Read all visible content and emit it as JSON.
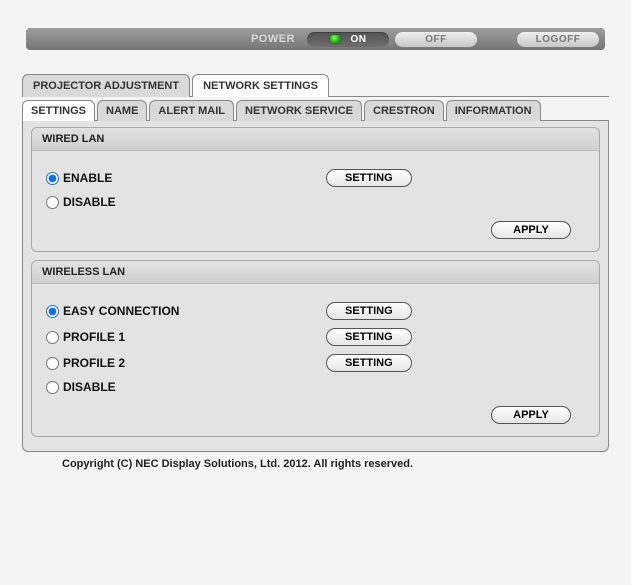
{
  "topbar": {
    "power_label": "POWER",
    "on_label": "ON",
    "off_label": "OFF",
    "logoff_label": "LOGOFF"
  },
  "tabs": {
    "main": [
      "PROJECTOR ADJUSTMENT",
      "NETWORK SETTINGS"
    ],
    "main_active": 1,
    "sub": [
      "SETTINGS",
      "NAME",
      "ALERT MAIL",
      "NETWORK SERVICE",
      "CRESTRON",
      "INFORMATION"
    ],
    "sub_active": 0
  },
  "wired": {
    "title": "WIRED LAN",
    "options": [
      "ENABLE",
      "DISABLE"
    ],
    "selected": 0,
    "setting_btn": "SETTING",
    "apply_btn": "APPLY"
  },
  "wireless": {
    "title": "WIRELESS LAN",
    "options": [
      "EASY CONNECTION",
      "PROFILE 1",
      "PROFILE 2",
      "DISABLE"
    ],
    "selected": 0,
    "setting_btn": "SETTING",
    "apply_btn": "APPLY"
  },
  "footer": "Copyright (C) NEC Display Solutions, Ltd. 2012. All rights reserved."
}
